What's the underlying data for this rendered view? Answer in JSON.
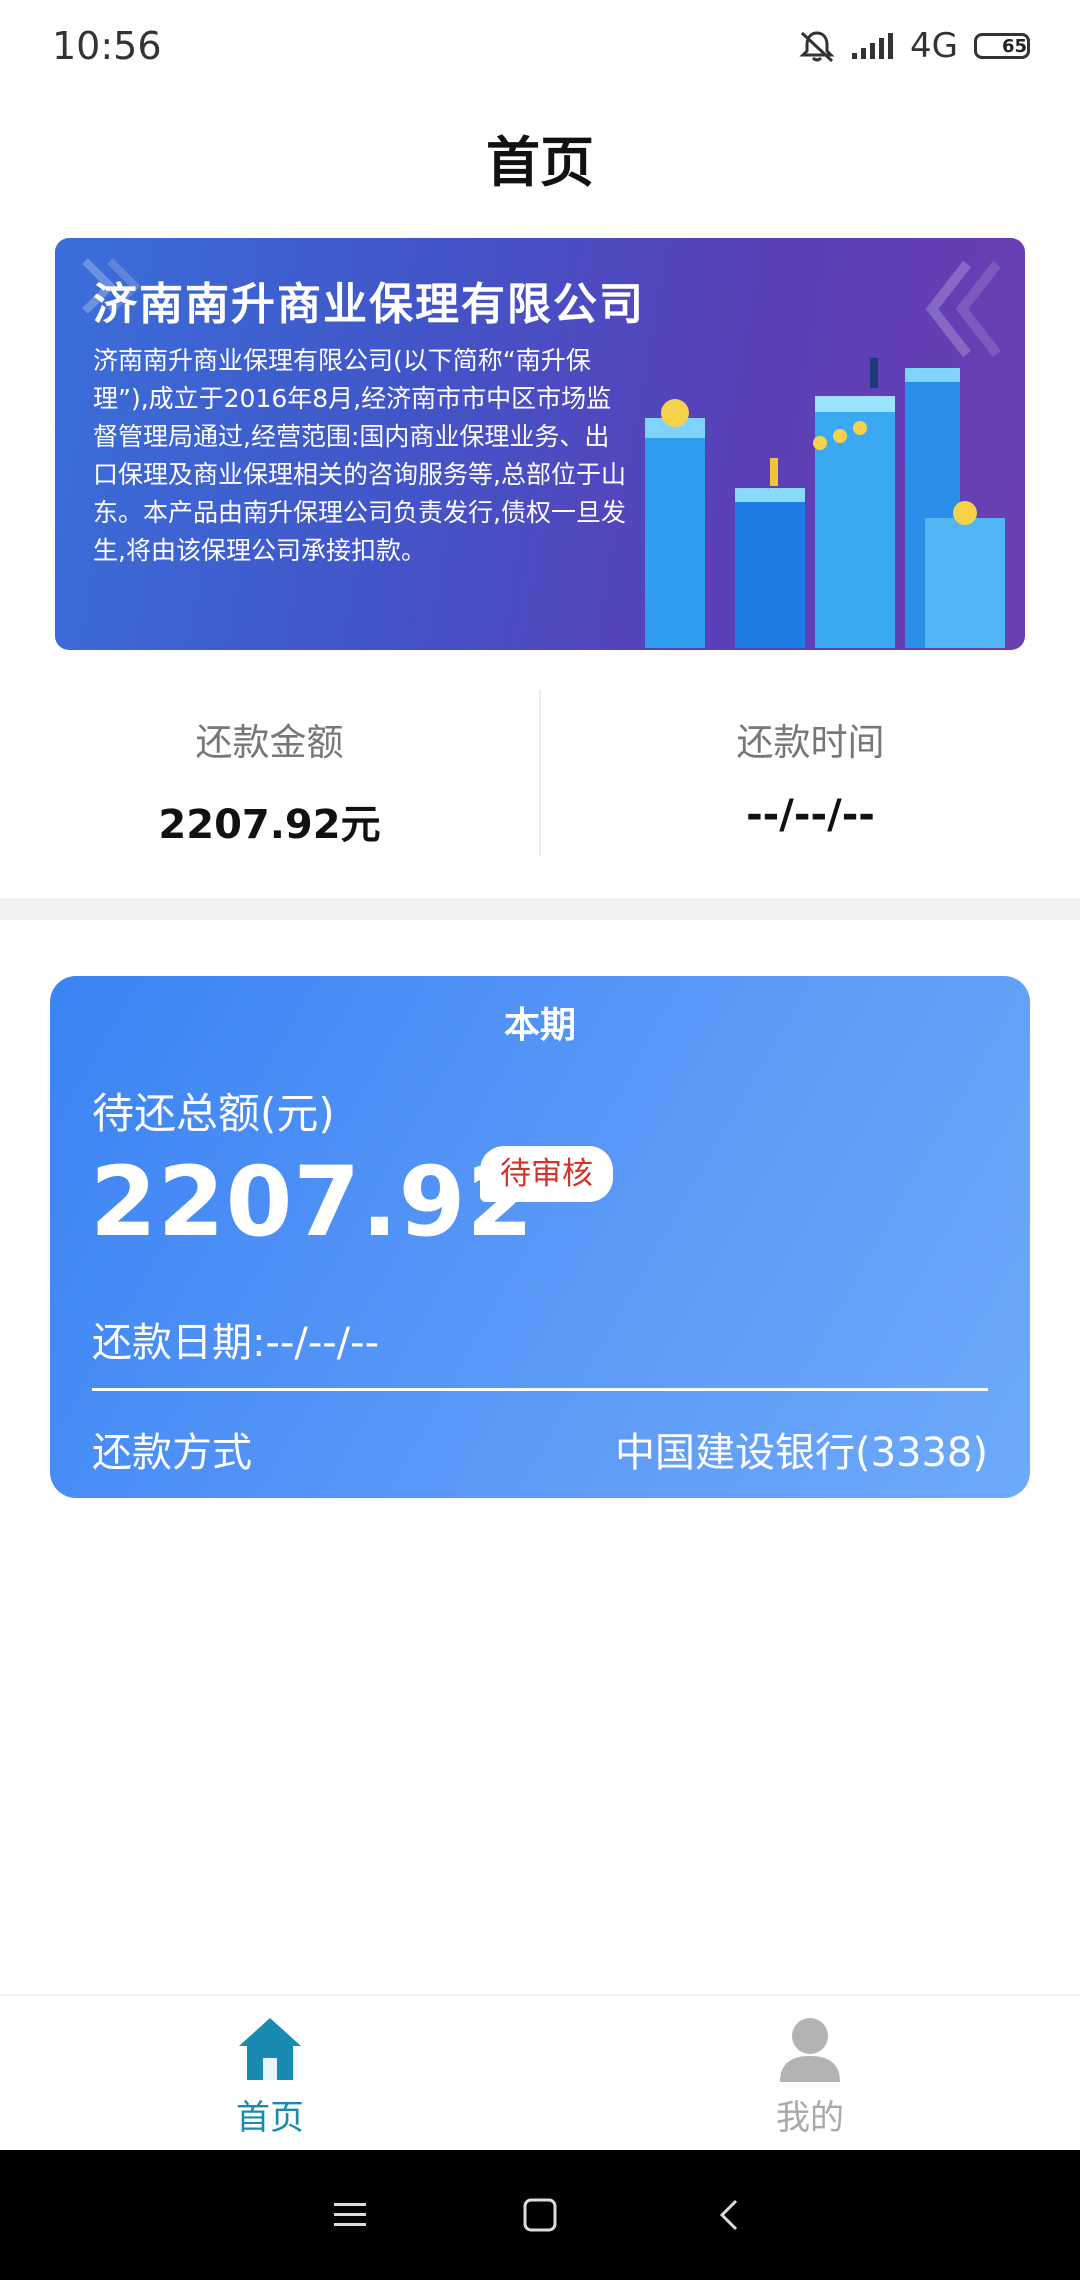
{
  "status_bar": {
    "time": "10:56",
    "network": "4G",
    "battery": "65"
  },
  "header": {
    "title": "首页"
  },
  "banner": {
    "title": "济南南升商业保理有限公司",
    "description": "济南南升商业保理有限公司(以下简称“南升保理”),成立于2016年8月,经济南市市中区市场监督管理局通过,经营范围:国内商业保理业务、出口保理及商业保理相关的咨询服务等,总部位于山东。本产品由南升保理公司负责发行,债权一旦发生,将由该保理公司承接扣款。"
  },
  "stats": {
    "amount_label": "还款金额",
    "amount_value": "2207.92元",
    "time_label": "还款时间",
    "time_value": "--/--/--"
  },
  "period_card": {
    "title": "本期",
    "total_label": "待还总额(元)",
    "total_amount": "2207.92",
    "status_badge": "待审核",
    "due_date": "还款日期:--/--/--",
    "method_label": "还款方式",
    "method_value": "中国建设银行(3338)"
  },
  "bottom_nav": {
    "items": [
      {
        "label": "首页",
        "icon": "home-icon",
        "active": true
      },
      {
        "label": "我的",
        "icon": "user-icon",
        "active": false
      }
    ]
  },
  "colors": {
    "accent": "#1a8bb0",
    "card_start": "#3b83f4",
    "card_end": "#6daafb",
    "badge_text": "#d2332d"
  }
}
